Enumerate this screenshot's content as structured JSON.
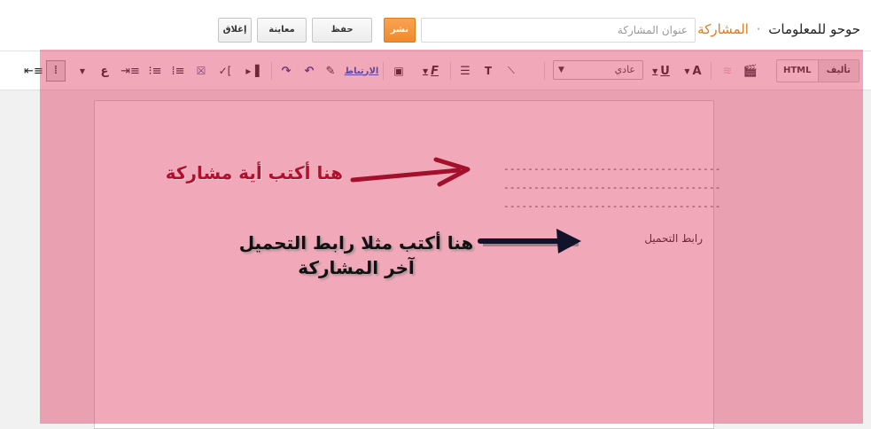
{
  "header": {
    "blog_name": "حوحو للمعلومات",
    "separator": "·",
    "section": "المشاركة",
    "title_placeholder": "عنوان المشاركة",
    "buttons": {
      "publish": "نشر",
      "save": "حفظ",
      "preview": "معاينة",
      "close": "إغلاق"
    }
  },
  "toolbar": {
    "mode_compose": "تأليف",
    "mode_html": "HTML",
    "format_select": "عادي",
    "link_label": "الارتباط",
    "font_letter": "A",
    "underline_letter": "U",
    "italic_letter": "F",
    "ta_letter": "T",
    "lang_letter": "ع"
  },
  "editor": {
    "dash_lines": [
      "------------------------------------",
      "------------------------------------",
      "------------------------------------"
    ],
    "download_link_label": "رابط التحميل"
  },
  "annotations": {
    "write_post": "هنا أكتب أية مشاركة",
    "write_link": "هنا أكتب مثلا رابط التحميل آخر المشاركة"
  },
  "colors": {
    "accent": "#e07b1c",
    "overlay": "#dd325a",
    "annotation_red": "#b0102e",
    "annotation_dark": "#111111"
  }
}
